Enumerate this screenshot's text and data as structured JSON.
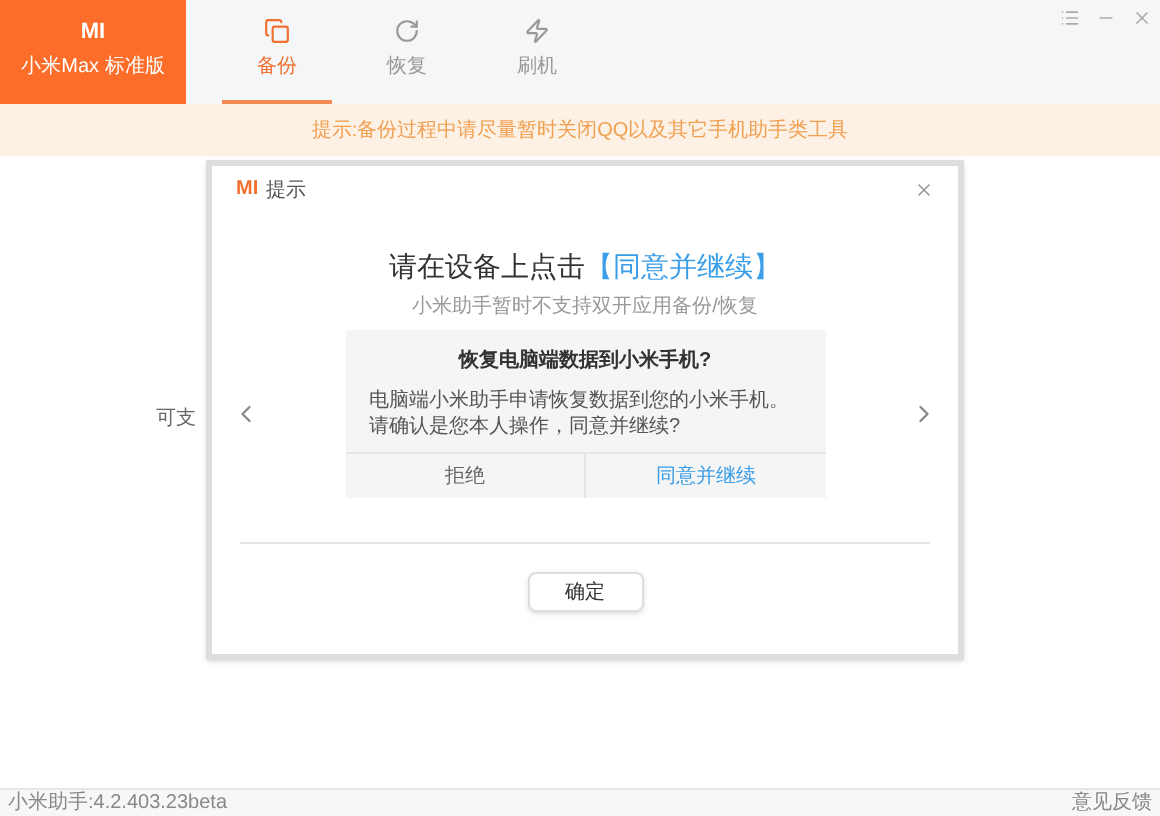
{
  "brand": {
    "logo": "MI",
    "device": "小米Max 标准版"
  },
  "tabs": [
    {
      "label": "备份",
      "selected": true
    },
    {
      "label": "恢复",
      "selected": false
    },
    {
      "label": "刷机",
      "selected": false
    }
  ],
  "notice": "提示:备份过程中请尽量暂时关闭QQ以及其它手机助手类工具",
  "background_text": "可支",
  "dialog": {
    "logo": "MI",
    "title": "提示",
    "heading": "请在设备上点击",
    "heading_link": "【同意并继续】",
    "subtitle": "小米助手暂时不支持双开应用备份/恢复",
    "phone_prompt": {
      "title": "恢复电脑端数据到小米手机?",
      "body": "电脑端小米助手申请恢复数据到您的小米手机。请确认是您本人操作，同意并继续?",
      "buttons": [
        {
          "label": "拒绝",
          "primary": false
        },
        {
          "label": "同意并继续",
          "primary": true
        }
      ]
    },
    "confirm": "确定"
  },
  "status_bar": {
    "version": "小米助手:4.2.403.23beta",
    "feedback": "意见反馈"
  }
}
